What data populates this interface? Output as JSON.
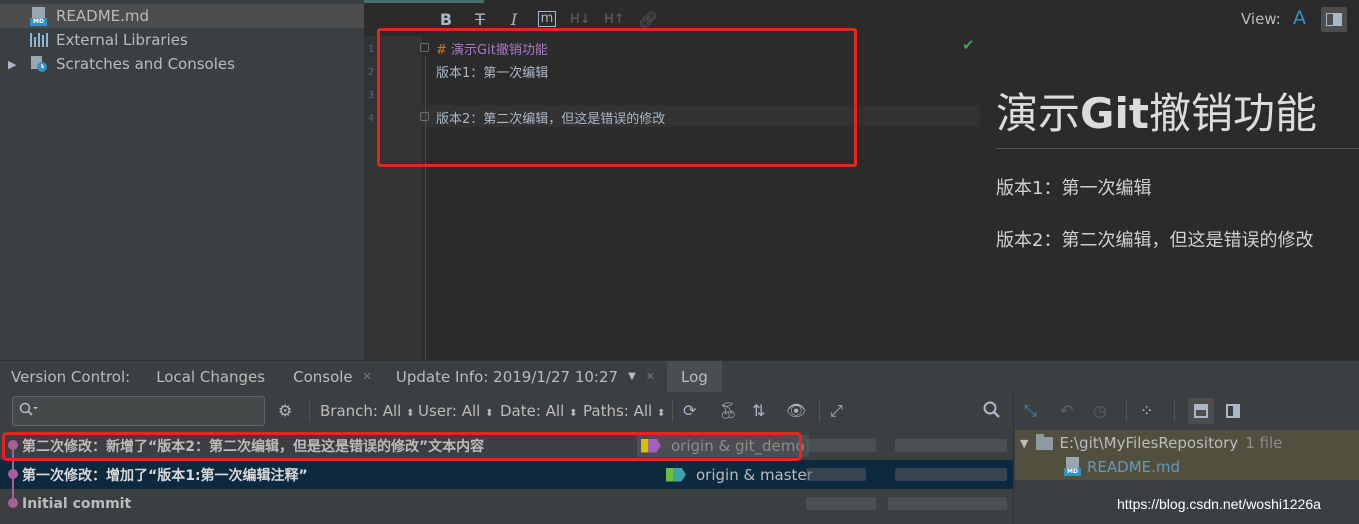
{
  "project_tree": {
    "items": [
      {
        "label": "README.md",
        "icon": "markdown-file-icon",
        "selected": true
      },
      {
        "label": "External Libraries",
        "icon": "libraries-icon"
      },
      {
        "label": "Scratches and Consoles",
        "icon": "scratches-icon",
        "expandable": true
      }
    ]
  },
  "markdown_toolbar": {
    "bold": "B",
    "strikethrough": "T",
    "italic": "I",
    "code": "m",
    "header_down": "H↓",
    "header_up": "H↑",
    "link": "link-icon"
  },
  "view": {
    "label": "View:",
    "mode_text": "A"
  },
  "editor": {
    "line_numbers": [
      "1",
      "2",
      "3",
      "4"
    ],
    "lines": {
      "line1_hash": "# ",
      "line1_text": "演示Git撤销功能",
      "line2": "版本1：第一次编辑",
      "line3": "",
      "line4": "版本2：第二次编辑，但这是错误的修改"
    }
  },
  "preview": {
    "heading_pre": "演示",
    "heading_bold": "Git",
    "heading_post": "撤销功能",
    "p1": "版本1：第一次编辑",
    "p2": "版本2：第二次编辑，但这是错误的修改"
  },
  "vc_tabs": {
    "title": "Version Control:",
    "local_changes": "Local Changes",
    "console": "Console",
    "update_info": "Update Info: 2019/1/27 10:27",
    "log": "Log"
  },
  "log_toolbar": {
    "search_placeholder": "",
    "branch": "Branch: All",
    "user": "User: All",
    "date": "Date: All",
    "paths": "Paths: All"
  },
  "commits": [
    {
      "message": "第二次修改：新增了“版本2：第二次编辑，但是这是错误的修改”文本内容",
      "refs": "origin & git_demo"
    },
    {
      "message": "第一次修改：增加了“版本1:第一次编辑注释”",
      "refs": "origin & master"
    },
    {
      "message": "Initial commit",
      "refs": ""
    }
  ],
  "details": {
    "repo_path": "E:\\git\\MyFilesRepository",
    "file_count": "1 file",
    "file_name": "README.md"
  },
  "watermark": "https://blog.csdn.net/woshi1226a",
  "colors": {
    "accent": "#3592c4",
    "highlight_box": "#e8251c",
    "graph": "#a55f9c",
    "selected_row": "#0d293e"
  }
}
